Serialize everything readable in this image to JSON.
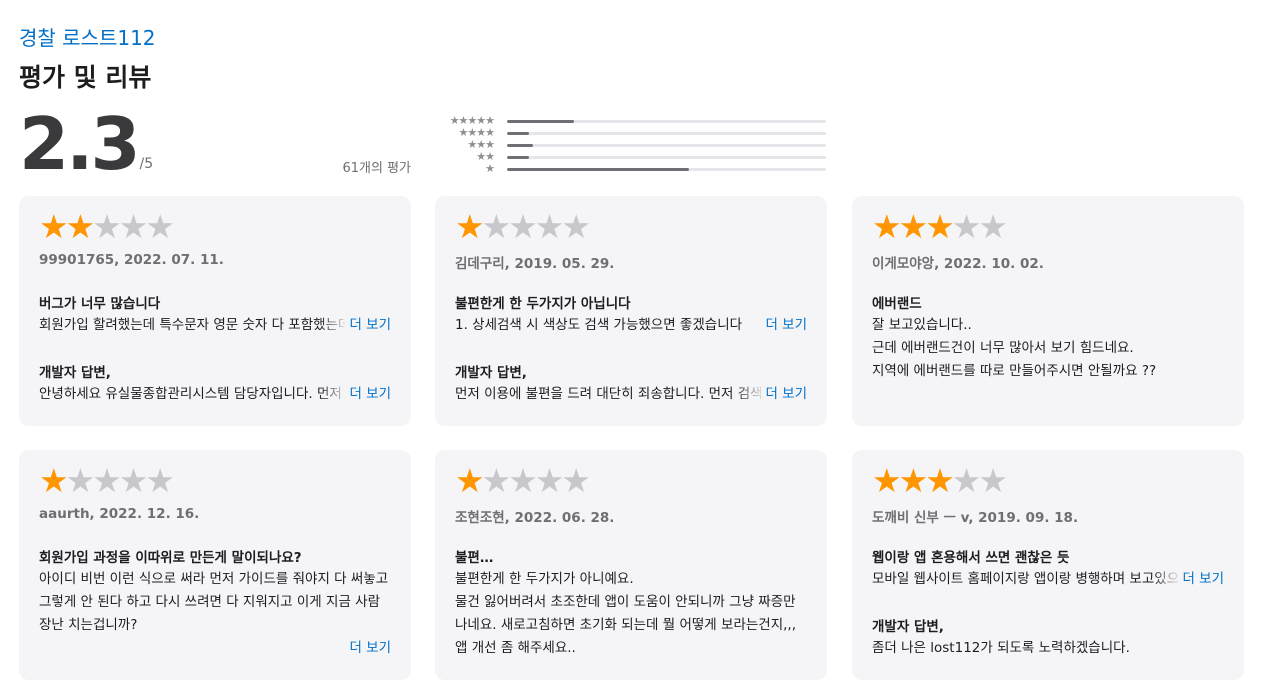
{
  "app": {
    "title": "경찰 로스트112"
  },
  "section": {
    "title": "평가 및 리뷰"
  },
  "summary": {
    "rating": "2.3",
    "out_of": "/5",
    "count_label": "61개의 평가"
  },
  "histogram": [
    {
      "stars": "★★★★★",
      "fraction": 0.21
    },
    {
      "stars": "★★★★",
      "fraction": 0.07
    },
    {
      "stars": "★★★",
      "fraction": 0.08
    },
    {
      "stars": "★★",
      "fraction": 0.07
    },
    {
      "stars": "★",
      "fraction": 0.57
    }
  ],
  "more_label": "더 보기",
  "dev_label": "개발자 답변,",
  "colors": {
    "accent": "#0070c9",
    "star_on": "#ff9500",
    "star_off": "#c7c7cc",
    "card_bg": "#f5f5f7"
  },
  "reviews": [
    {
      "rating": 2,
      "author": "99901765, 2022. 07. 11.",
      "title": "버그가 너무 많습니다",
      "body": "회원가입 할려했는데 특수문자 영문 숫자 다 포함했는데",
      "dev_reply": "안녕하세요 유실물종합관리시스템 담당자입니다. 먼저"
    },
    {
      "rating": 1,
      "author": "김데구리, 2019. 05. 29.",
      "title": "불편한게 한 두가지가 아닙니다",
      "body": "1. 상세검색 시 색상도 검색 가능했으면 좋겠습니다",
      "dev_reply": "먼저 이용에 불편을 드려 대단히 죄송합니다. 먼저 검색"
    },
    {
      "rating": 3,
      "author": "이게모야앙, 2022. 10. 02.",
      "title": "에버랜드",
      "body_lines": [
        "잘 보고있습니다..",
        "근데 에버랜드건이 너무 많아서 보기 힘드네요.",
        "지역에 에버랜드를 따로 만들어주시면 안될까요 ??"
      ]
    },
    {
      "rating": 1,
      "author": "aaurth, 2022. 12. 16.",
      "title": "회원가입 과정을 이따위로 만든게 말이되나요?",
      "body_lines": [
        "아이디 비번 이런 식으로 써라 먼저 가이드를 줘야지 다 써놓고",
        "그렇게 안 된다 하고 다시 쓰려면 다 지워지고 이게 지금 사람",
        "장난 치는겁니까?"
      ]
    },
    {
      "rating": 1,
      "author": "조현조현, 2022. 06. 28.",
      "title": "불편…",
      "body_lines": [
        "불편한게 한 두가지가 아니예요.",
        "물건 잃어버려서 초조한데 앱이 도움이 안되니까 그냥 짜증만",
        "나네요. 새로고침하면 초기화 되는데 뭘 어떻게 보라는건지,,,",
        "앱 개선 좀 해주세요.."
      ]
    },
    {
      "rating": 3,
      "author": "도깨비 신부 ㅡ v, 2019. 09. 18.",
      "title": "웹이랑 앱 혼용해서 쓰면 괜찮은 듯",
      "body": "모바일 웹사이트 홈페이지랑 앱이랑 병행하며 보고있으",
      "dev_reply": "좀더 나은 lost112가 되도록 노력하겠습니다."
    }
  ]
}
